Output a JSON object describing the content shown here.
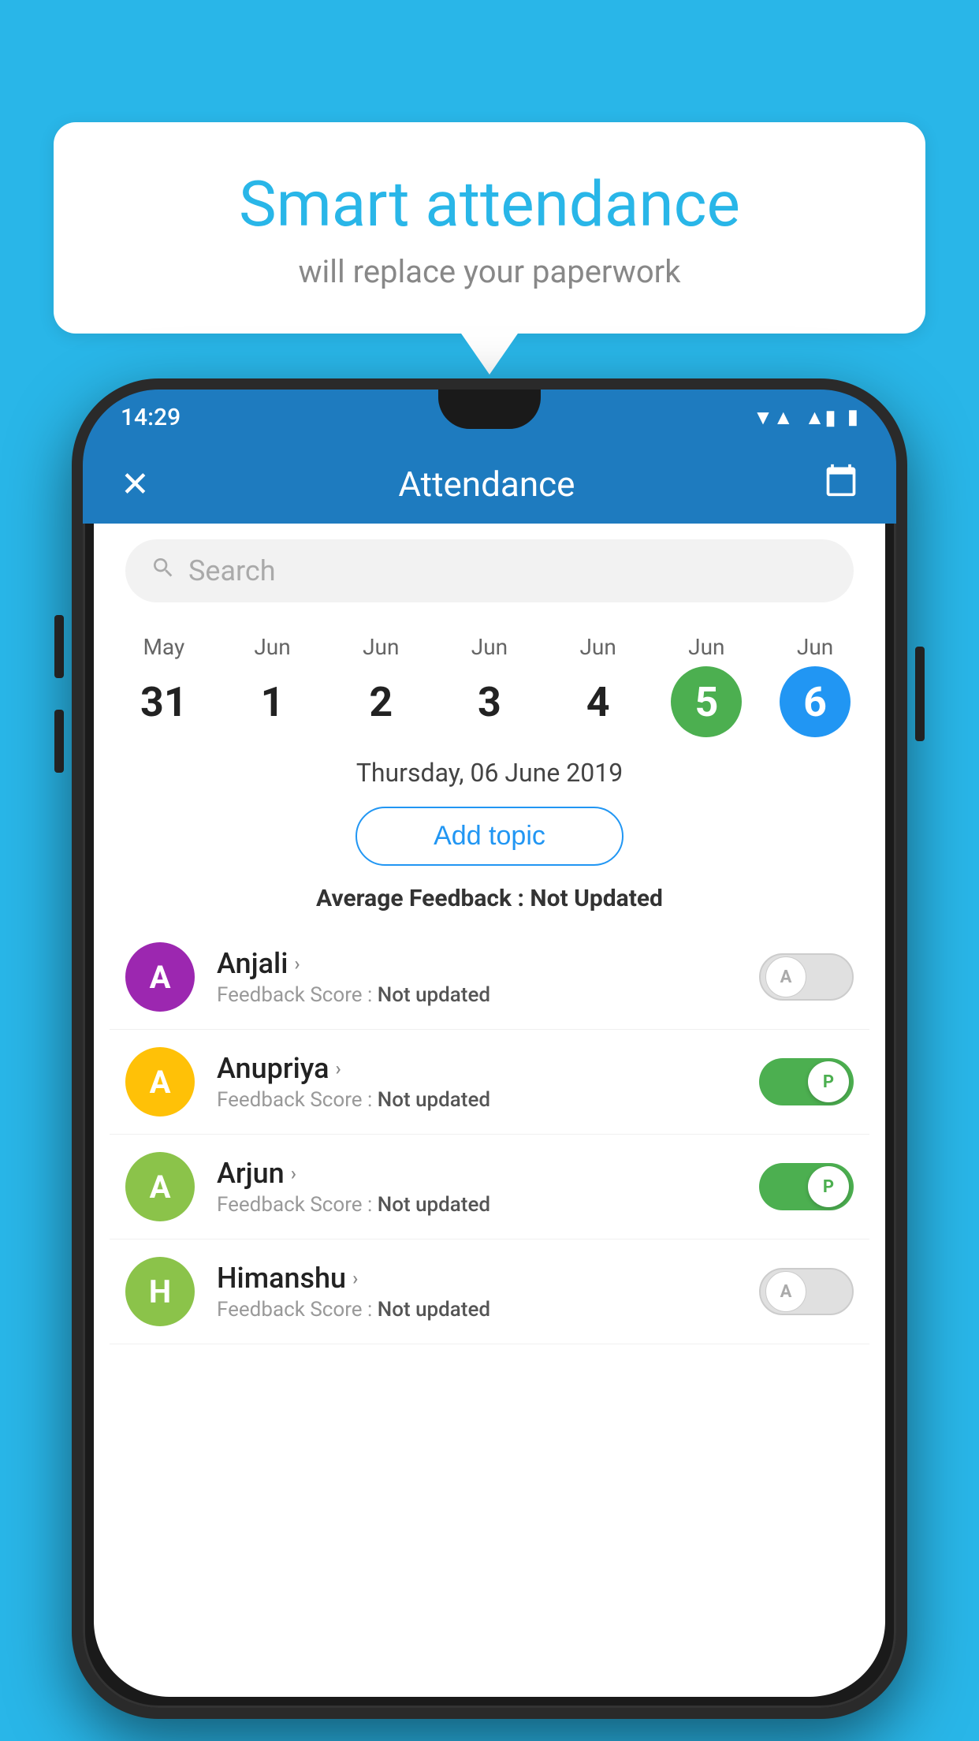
{
  "background": {
    "color": "#29b6e8"
  },
  "speech_bubble": {
    "title": "Smart attendance",
    "subtitle": "will replace your paperwork"
  },
  "phone": {
    "status_bar": {
      "time": "14:29",
      "wifi": "▼▲",
      "signal": "▲",
      "battery": "▮"
    },
    "header": {
      "close_label": "✕",
      "title": "Attendance",
      "calendar_icon": "📅"
    },
    "search": {
      "placeholder": "Search"
    },
    "calendar": {
      "days": [
        {
          "month": "May",
          "date": "31",
          "style": "normal"
        },
        {
          "month": "Jun",
          "date": "1",
          "style": "normal"
        },
        {
          "month": "Jun",
          "date": "2",
          "style": "normal"
        },
        {
          "month": "Jun",
          "date": "3",
          "style": "normal"
        },
        {
          "month": "Jun",
          "date": "4",
          "style": "normal"
        },
        {
          "month": "Jun",
          "date": "5",
          "style": "green"
        },
        {
          "month": "Jun",
          "date": "6",
          "style": "blue"
        }
      ]
    },
    "selected_date": "Thursday, 06 June 2019",
    "add_topic_label": "Add topic",
    "avg_feedback_label": "Average Feedback :",
    "avg_feedback_value": "Not Updated",
    "students": [
      {
        "name": "Anjali",
        "initial": "A",
        "avatar_color": "#9c27b0",
        "feedback_label": "Feedback Score :",
        "feedback_value": "Not updated",
        "attendance": "absent",
        "knob_label": "A"
      },
      {
        "name": "Anupriya",
        "initial": "A",
        "avatar_color": "#ffc107",
        "feedback_label": "Feedback Score :",
        "feedback_value": "Not updated",
        "attendance": "present",
        "knob_label": "P"
      },
      {
        "name": "Arjun",
        "initial": "A",
        "avatar_color": "#8bc34a",
        "feedback_label": "Feedback Score :",
        "feedback_value": "Not updated",
        "attendance": "present",
        "knob_label": "P"
      },
      {
        "name": "Himanshu",
        "initial": "H",
        "avatar_color": "#8bc34a",
        "feedback_label": "Feedback Score :",
        "feedback_value": "Not updated",
        "attendance": "absent",
        "knob_label": "A"
      }
    ]
  }
}
